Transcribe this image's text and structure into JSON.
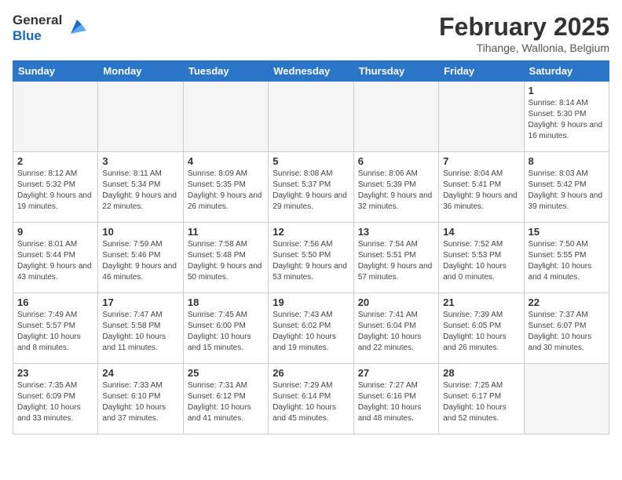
{
  "header": {
    "logo_line1": "General",
    "logo_line2": "Blue",
    "month_year": "February 2025",
    "location": "Tihange, Wallonia, Belgium"
  },
  "days_of_week": [
    "Sunday",
    "Monday",
    "Tuesday",
    "Wednesday",
    "Thursday",
    "Friday",
    "Saturday"
  ],
  "weeks": [
    [
      {
        "day": "",
        "info": ""
      },
      {
        "day": "",
        "info": ""
      },
      {
        "day": "",
        "info": ""
      },
      {
        "day": "",
        "info": ""
      },
      {
        "day": "",
        "info": ""
      },
      {
        "day": "",
        "info": ""
      },
      {
        "day": "1",
        "info": "Sunrise: 8:14 AM\nSunset: 5:30 PM\nDaylight: 9 hours and 16 minutes."
      }
    ],
    [
      {
        "day": "2",
        "info": "Sunrise: 8:12 AM\nSunset: 5:32 PM\nDaylight: 9 hours and 19 minutes."
      },
      {
        "day": "3",
        "info": "Sunrise: 8:11 AM\nSunset: 5:34 PM\nDaylight: 9 hours and 22 minutes."
      },
      {
        "day": "4",
        "info": "Sunrise: 8:09 AM\nSunset: 5:35 PM\nDaylight: 9 hours and 26 minutes."
      },
      {
        "day": "5",
        "info": "Sunrise: 8:08 AM\nSunset: 5:37 PM\nDaylight: 9 hours and 29 minutes."
      },
      {
        "day": "6",
        "info": "Sunrise: 8:06 AM\nSunset: 5:39 PM\nDaylight: 9 hours and 32 minutes."
      },
      {
        "day": "7",
        "info": "Sunrise: 8:04 AM\nSunset: 5:41 PM\nDaylight: 9 hours and 36 minutes."
      },
      {
        "day": "8",
        "info": "Sunrise: 8:03 AM\nSunset: 5:42 PM\nDaylight: 9 hours and 39 minutes."
      }
    ],
    [
      {
        "day": "9",
        "info": "Sunrise: 8:01 AM\nSunset: 5:44 PM\nDaylight: 9 hours and 43 minutes."
      },
      {
        "day": "10",
        "info": "Sunrise: 7:59 AM\nSunset: 5:46 PM\nDaylight: 9 hours and 46 minutes."
      },
      {
        "day": "11",
        "info": "Sunrise: 7:58 AM\nSunset: 5:48 PM\nDaylight: 9 hours and 50 minutes."
      },
      {
        "day": "12",
        "info": "Sunrise: 7:56 AM\nSunset: 5:50 PM\nDaylight: 9 hours and 53 minutes."
      },
      {
        "day": "13",
        "info": "Sunrise: 7:54 AM\nSunset: 5:51 PM\nDaylight: 9 hours and 57 minutes."
      },
      {
        "day": "14",
        "info": "Sunrise: 7:52 AM\nSunset: 5:53 PM\nDaylight: 10 hours and 0 minutes."
      },
      {
        "day": "15",
        "info": "Sunrise: 7:50 AM\nSunset: 5:55 PM\nDaylight: 10 hours and 4 minutes."
      }
    ],
    [
      {
        "day": "16",
        "info": "Sunrise: 7:49 AM\nSunset: 5:57 PM\nDaylight: 10 hours and 8 minutes."
      },
      {
        "day": "17",
        "info": "Sunrise: 7:47 AM\nSunset: 5:58 PM\nDaylight: 10 hours and 11 minutes."
      },
      {
        "day": "18",
        "info": "Sunrise: 7:45 AM\nSunset: 6:00 PM\nDaylight: 10 hours and 15 minutes."
      },
      {
        "day": "19",
        "info": "Sunrise: 7:43 AM\nSunset: 6:02 PM\nDaylight: 10 hours and 19 minutes."
      },
      {
        "day": "20",
        "info": "Sunrise: 7:41 AM\nSunset: 6:04 PM\nDaylight: 10 hours and 22 minutes."
      },
      {
        "day": "21",
        "info": "Sunrise: 7:39 AM\nSunset: 6:05 PM\nDaylight: 10 hours and 26 minutes."
      },
      {
        "day": "22",
        "info": "Sunrise: 7:37 AM\nSunset: 6:07 PM\nDaylight: 10 hours and 30 minutes."
      }
    ],
    [
      {
        "day": "23",
        "info": "Sunrise: 7:35 AM\nSunset: 6:09 PM\nDaylight: 10 hours and 33 minutes."
      },
      {
        "day": "24",
        "info": "Sunrise: 7:33 AM\nSunset: 6:10 PM\nDaylight: 10 hours and 37 minutes."
      },
      {
        "day": "25",
        "info": "Sunrise: 7:31 AM\nSunset: 6:12 PM\nDaylight: 10 hours and 41 minutes."
      },
      {
        "day": "26",
        "info": "Sunrise: 7:29 AM\nSunset: 6:14 PM\nDaylight: 10 hours and 45 minutes."
      },
      {
        "day": "27",
        "info": "Sunrise: 7:27 AM\nSunset: 6:16 PM\nDaylight: 10 hours and 48 minutes."
      },
      {
        "day": "28",
        "info": "Sunrise: 7:25 AM\nSunset: 6:17 PM\nDaylight: 10 hours and 52 minutes."
      },
      {
        "day": "",
        "info": ""
      }
    ]
  ]
}
